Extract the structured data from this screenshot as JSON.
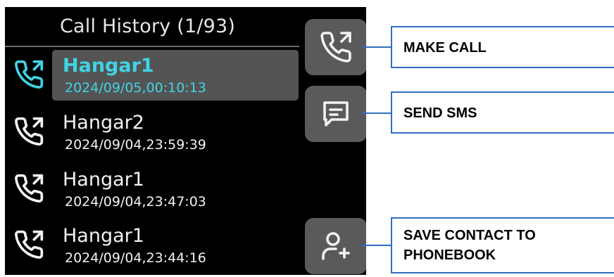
{
  "header": {
    "title": "Call History (1/93)"
  },
  "calls": [
    {
      "name": "Hangar1",
      "datetime": "2024/09/05,00:10:13",
      "selected": true
    },
    {
      "name": "Hangar2",
      "datetime": "2024/09/04,23:59:39",
      "selected": false
    },
    {
      "name": "Hangar1",
      "datetime": "2024/09/04,23:47:03",
      "selected": false
    },
    {
      "name": "Hangar1",
      "datetime": "2024/09/04,23:44:16",
      "selected": false
    }
  ],
  "buttons": {
    "make_call": {
      "icon": "phone-outgoing-icon"
    },
    "send_sms": {
      "icon": "message-icon"
    },
    "save_contact": {
      "icon": "add-contact-icon"
    }
  },
  "callouts": {
    "make_call": "MAKE CALL",
    "send_sms": "SEND SMS",
    "save_contact_line1": "SAVE CONTACT TO",
    "save_contact_line2": "PHONEBOOK"
  },
  "colors": {
    "screen_bg": "#000000",
    "accent": "#41d3e4",
    "text": "#f2f2f2",
    "button_bg": "#5a5a5a",
    "highlight_bg": "#545454",
    "callout_border": "#2f6fbf"
  }
}
